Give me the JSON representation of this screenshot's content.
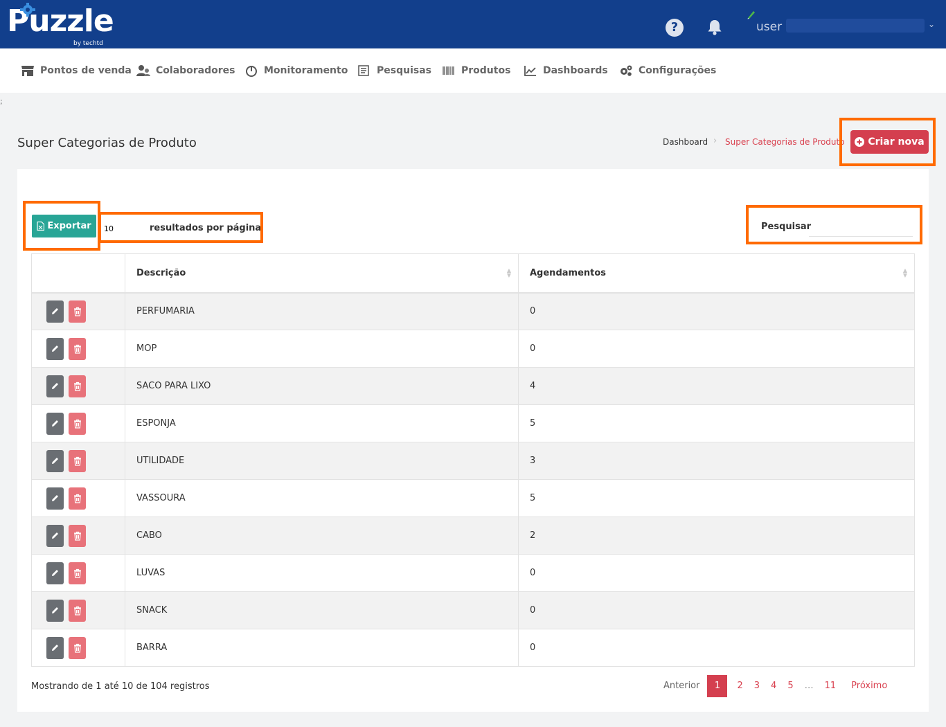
{
  "header": {
    "logo_text": "Puzzle",
    "logo_sub": "by techtd",
    "user_name": "user"
  },
  "nav": {
    "items": [
      {
        "label": "Pontos de venda",
        "icon": "store-icon"
      },
      {
        "label": "Colaboradores",
        "icon": "users-icon"
      },
      {
        "label": "Monitoramento",
        "icon": "gauge-icon"
      },
      {
        "label": "Pesquisas",
        "icon": "survey-icon"
      },
      {
        "label": "Produtos",
        "icon": "barcode-icon"
      },
      {
        "label": "Dashboards",
        "icon": "chart-icon"
      },
      {
        "label": "Configurações",
        "icon": "gears-icon"
      }
    ]
  },
  "stray_char": ";",
  "page": {
    "title": "Super Categorias de Produto",
    "breadcrumb": {
      "home": "Dashboard",
      "separator": "›",
      "current": "Super Categorias de Produto"
    },
    "create_label": "Criar nova"
  },
  "toolbar": {
    "export_label": "Exportar",
    "per_page_value": "10",
    "per_page_label": "resultados por página",
    "search_label": "Pesquisar",
    "search_value": ""
  },
  "table": {
    "columns": [
      "Descrição",
      "Agendamentos"
    ],
    "rows": [
      {
        "descricao": "PERFUMARIA",
        "agendamentos": "0"
      },
      {
        "descricao": "MOP",
        "agendamentos": "0"
      },
      {
        "descricao": "SACO PARA LIXO",
        "agendamentos": "4"
      },
      {
        "descricao": "ESPONJA",
        "agendamentos": "5"
      },
      {
        "descricao": "UTILIDADE",
        "agendamentos": "3"
      },
      {
        "descricao": "VASSOURA",
        "agendamentos": "5"
      },
      {
        "descricao": "CABO",
        "agendamentos": "2"
      },
      {
        "descricao": "LUVAS",
        "agendamentos": "0"
      },
      {
        "descricao": "SNACK",
        "agendamentos": "0"
      },
      {
        "descricao": "BARRA",
        "agendamentos": "0"
      }
    ]
  },
  "footer": {
    "info": "Mostrando de 1 até 10 de 104 registros",
    "prev": "Anterior",
    "pages": [
      "1",
      "2",
      "3",
      "4",
      "5",
      "…",
      "11"
    ],
    "current_page": "1",
    "next": "Próximo"
  },
  "colors": {
    "topbar": "#123f8c",
    "primary_red": "#d43f4f",
    "export_teal": "#28a596",
    "highlight": "#ff6a00"
  }
}
